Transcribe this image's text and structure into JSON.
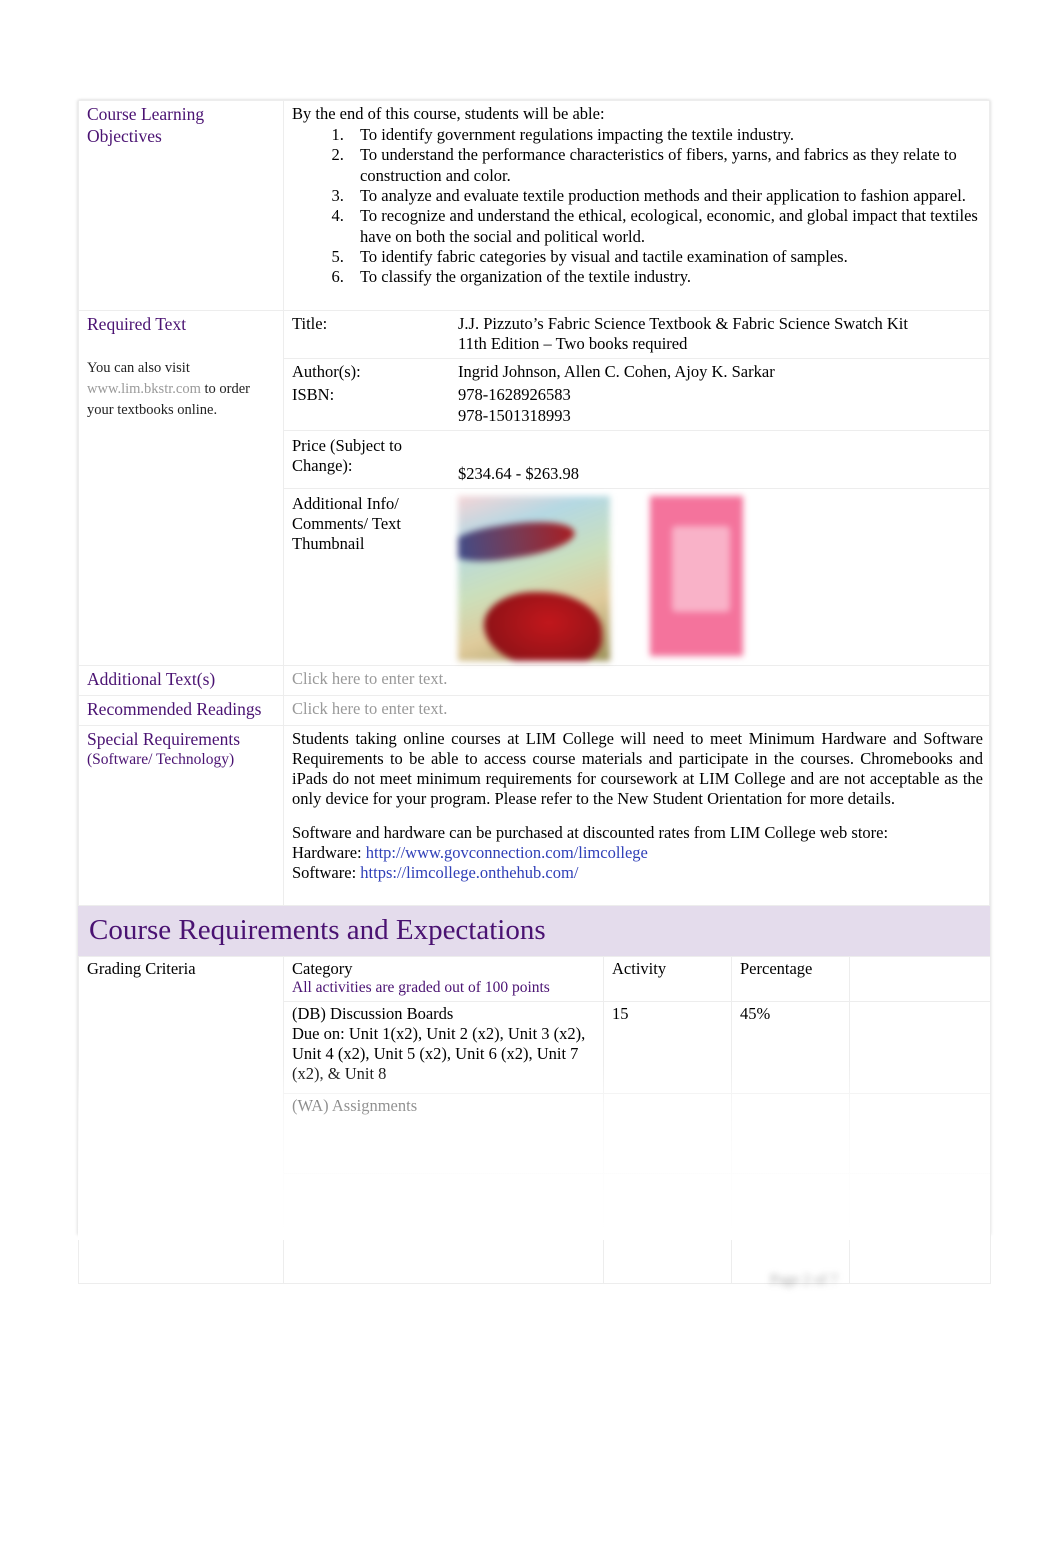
{
  "document": {
    "footer_note": "Page 2 of 7"
  },
  "sections": {
    "learning_objectives": {
      "label": "Course Learning Objectives",
      "intro": "By the end of this course, students will be able:",
      "items": [
        "To identify government regulations impacting the textile industry.",
        "To understand the performance characteristics of fibers, yarns, and fabrics as they relate to construction and color.",
        "To analyze and evaluate textile production methods and their application to fashion apparel.",
        "To recognize and understand the ethical, ecological, economic, and global impact that textiles have on both the social and political world.",
        "To identify fabric categories by visual and tactile examination of samples.",
        "To classify the organization of the textile industry."
      ]
    },
    "required_text": {
      "label": "Required Text",
      "note_before": "You can also visit",
      "note_link": "www.lim.bkstr.com",
      "note_after": "to order your textbooks online.",
      "fields": {
        "title_key": "Title:",
        "title_value_line1": "J.J. Pizzuto’s Fabric Science Textbook & Fabric Science Swatch Kit",
        "title_value_line2": "11th Edition – Two books required",
        "authors_key": "Author(s):",
        "authors_value": "Ingrid Johnson, Allen C. Cohen, Ajoy K. Sarkar",
        "isbn_key": "ISBN:",
        "isbn_value_1": "978-1628926583",
        "isbn_value_2": "978-1501318993",
        "price_key": "Price (Subject to Change):",
        "price_value": "$234.64 - $263.98",
        "thumbnail_key": "Additional Info/ Comments/ Text Thumbnail"
      }
    },
    "additional_text": {
      "label": "Additional Text(s)",
      "value": "Click here to enter text."
    },
    "recommended_readings": {
      "label": "Recommended Readings",
      "value": "Click here to enter text."
    },
    "special_requirements": {
      "label": "Special Requirements",
      "sublabel": "(Software/ Technology)",
      "paragraph": "Students taking online courses at LIM College will need to meet Minimum Hardware and Software Requirements to be able to access course materials and participate in the courses. Chromebooks and iPads do not meet minimum requirements for coursework at LIM College and are not acceptable as the only device for your program. Please refer to the New Student Orientation for more details.",
      "purchase_line": "Software and hardware can be purchased at discounted rates from LIM College web store:",
      "hardware_label": "Hardware:",
      "hardware_url": "http://www.govconnection.com/limcollege",
      "software_label": "Software:",
      "software_url": "https://limcollege.onthehub.com/"
    }
  },
  "course_requirements": {
    "banner_title": "Course Requirements and Expectations",
    "grading_criteria_label": "Grading Criteria",
    "columns": {
      "category": "Category",
      "activity": "Activity",
      "percentage": "Percentage"
    },
    "grading_note": "All activities are graded out of 100 points",
    "rows": [
      {
        "category": "(DB) Discussion Boards",
        "detail": "Due on: Unit 1(x2), Unit 2 (x2), Unit 3 (x2), Unit 4 (x2), Unit 5 (x2), Unit 6 (x2), Unit 7 (x2), & Unit 8",
        "activity": "15",
        "percentage": "45%"
      },
      {
        "category": "(WA) Assignments",
        "detail": "",
        "activity": "",
        "percentage": ""
      },
      {
        "category": "",
        "detail": "",
        "activity": "",
        "percentage": ""
      },
      {
        "category": "",
        "detail": "",
        "activity": "",
        "percentage": ""
      }
    ]
  },
  "colors": {
    "heading_purple": "#4a1272",
    "banner_background": "#e4dcec",
    "link_blue": "#2f3fb8",
    "placeholder_grey": "#999999"
  }
}
